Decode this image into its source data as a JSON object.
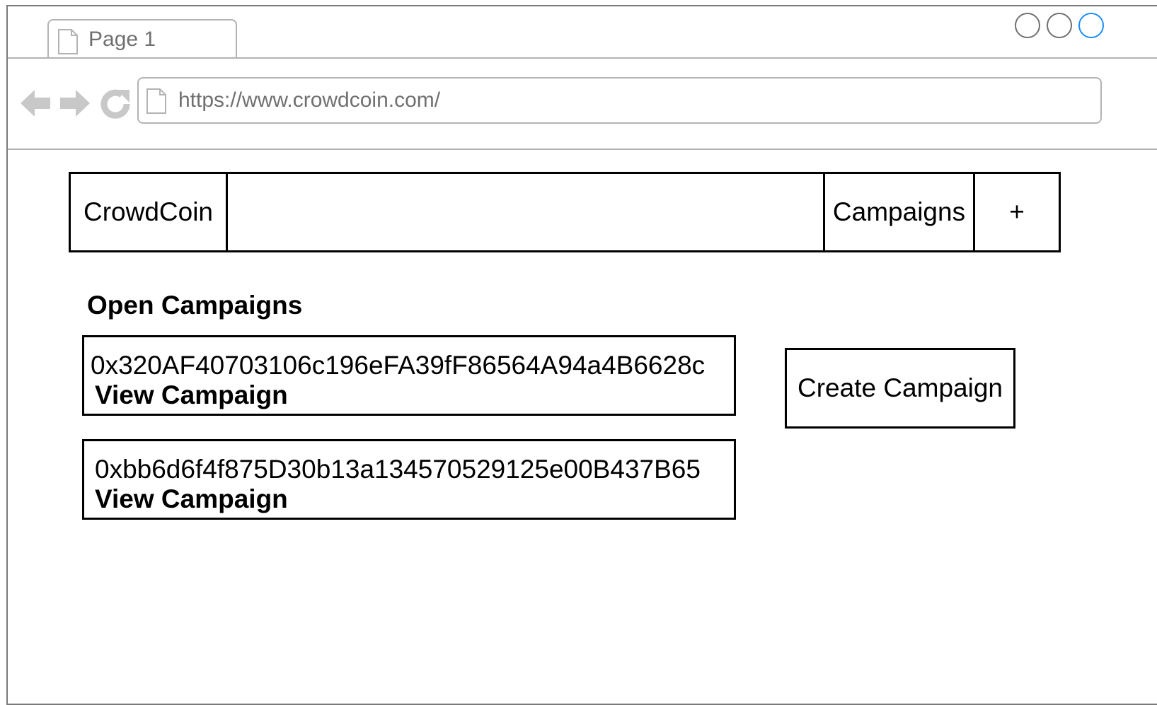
{
  "browser": {
    "tab": {
      "label": "Page 1",
      "icon": "page-icon"
    },
    "url": "https://www.crowdcoin.com/",
    "nav_icons": [
      "back-arrow-icon",
      "forward-arrow-icon",
      "reload-icon"
    ],
    "window_controls": [
      "minimize",
      "maximize",
      "close"
    ]
  },
  "header": {
    "brand": "CrowdCoin",
    "campaigns_link": "Campaigns",
    "add_button": "+"
  },
  "main": {
    "section_title": "Open Campaigns",
    "campaigns": [
      {
        "address": "0x320AF40703106c196eFA39fF86564A94a4B6628c",
        "link_label": "View Campaign"
      },
      {
        "address": "0xbb6d6f4f875D30b13a134570529125e00B437B65",
        "link_label": "View Campaign"
      }
    ],
    "create_button": "Create Campaign"
  },
  "colors": {
    "chrome_border": "#b3b3b3",
    "chrome_text": "#707070",
    "close_button_accent": "#1a8cff",
    "content_border": "#000000"
  }
}
